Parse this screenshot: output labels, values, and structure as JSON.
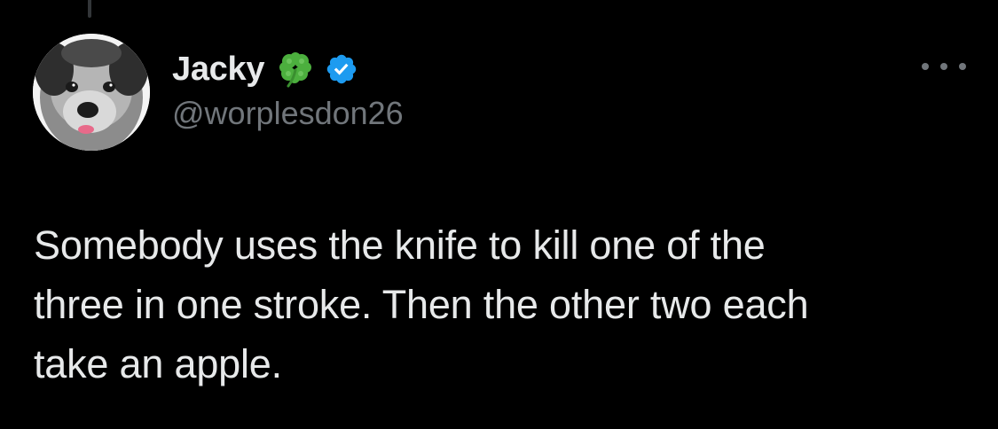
{
  "tweet": {
    "author": {
      "display_name": "Jacky",
      "handle": "@worplesdon26",
      "badges": [
        "four-leaf-clover-icon",
        "verified-badge-icon"
      ],
      "verified_color": "#1d9bf0"
    },
    "text": "Somebody uses the knife to kill one of the\nthree in one stroke. Then the other two each\ntake an apple.",
    "more_menu_icon": "ellipsis-icon"
  },
  "colors": {
    "background": "#000000",
    "primary_text": "#e7e9ea",
    "secondary_text": "#71767b",
    "clover_green": "#4caf3e"
  }
}
